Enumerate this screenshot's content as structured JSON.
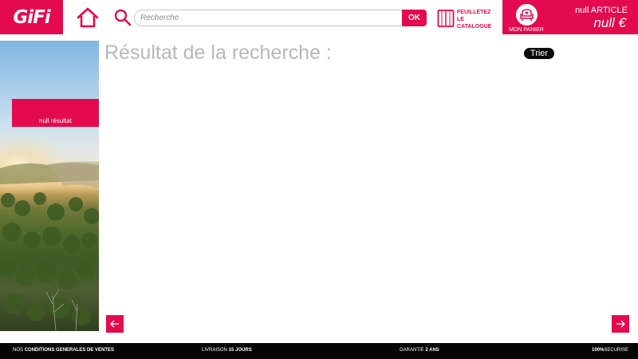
{
  "header": {
    "logo_text": "GiFi",
    "search": {
      "placeholder": "Recherche",
      "value": "",
      "ok_label": "OK"
    },
    "catalogue": {
      "line1": "FEUILLETEZ",
      "line2": "LE",
      "line3": "CATALOGUE"
    },
    "cart": {
      "label": "MON PANIER",
      "count_text": "null ARTICLE",
      "total_text": "null €"
    }
  },
  "sidebar": {
    "result_count": "null résultat"
  },
  "main": {
    "title": "Résultat de la recherche :",
    "sort_label": "Trier"
  },
  "footer": {
    "items": [
      {
        "prefix": "NOS",
        "bold": "CONDITIONS GENERALES DE VENTES",
        "suffix": ""
      },
      {
        "prefix": "LIVRAISON",
        "bold": "15 JOURS",
        "suffix": ""
      },
      {
        "prefix": "GARANTIE",
        "bold": "2 ANS",
        "suffix": ""
      },
      {
        "prefix": "",
        "bold": "100%",
        "suffix": "SECURISE"
      }
    ]
  },
  "colors": {
    "brand": "#e30a4f",
    "footer_bg": "#050505",
    "title_text": "#b8b8b8"
  },
  "icons": {
    "home": "home-icon",
    "search": "search-icon",
    "catalogue": "book-icon",
    "cart": "armchair-icon",
    "prev": "arrow-left-icon",
    "next": "arrow-right-icon"
  }
}
